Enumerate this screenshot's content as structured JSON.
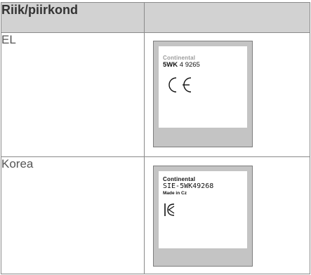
{
  "table": {
    "header": {
      "col1": "Riik/piirkond",
      "col2": ""
    },
    "rows": [
      {
        "country": "EL",
        "label": {
          "brand": "Continental",
          "part_prefix": "5WK",
          "part_number": "4  9265",
          "mark": "CE"
        }
      },
      {
        "country": "Korea",
        "label": {
          "brand": "Continental",
          "part_number": "SIE-5WK49268",
          "made_in": "Made in Cz",
          "mark": "KC"
        }
      }
    ]
  },
  "colors": {
    "header_bg": "#d2d2d2",
    "label_frame": "#c4c4c4",
    "border": "#8a8a8a"
  }
}
